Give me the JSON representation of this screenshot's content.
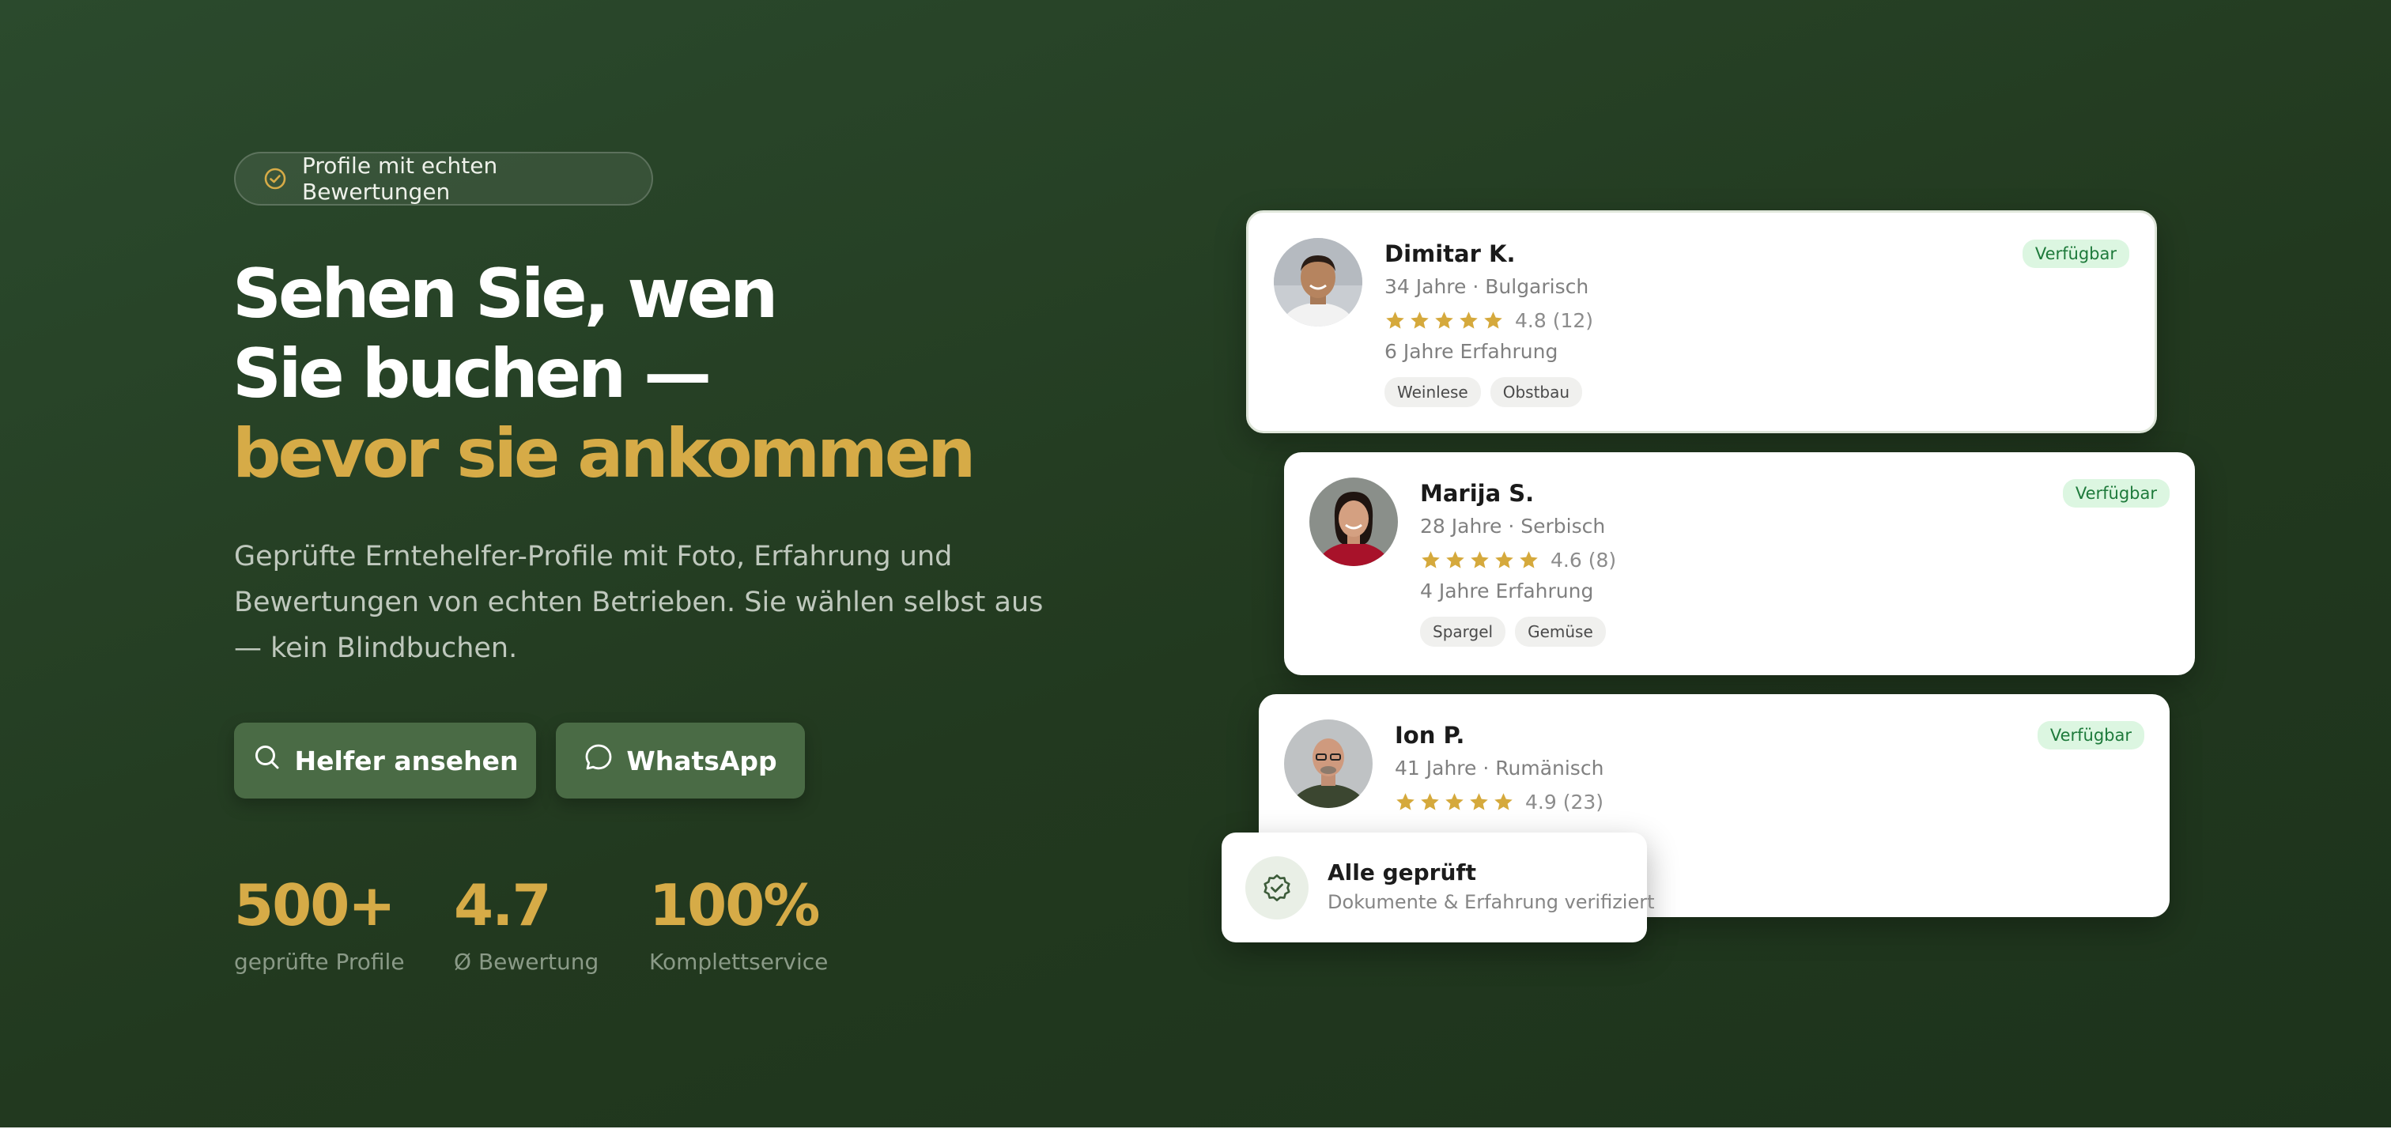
{
  "badge": {
    "text": "Profile mit echten Bewertungen",
    "icon": "check-circle-icon"
  },
  "headline": {
    "line1": "Sehen Sie, wen",
    "line2": "Sie buchen —",
    "line3": "bevor sie ankommen"
  },
  "lead": "Geprüfte Erntehelfer-Profile mit Foto, Erfahrung und Bewertungen von echten Betrieben. Sie wählen selbst aus — kein Blindbuchen.",
  "buttons": {
    "helpers": {
      "label": "Helfer ansehen",
      "icon": "search-icon"
    },
    "whatsapp": {
      "label": "WhatsApp",
      "icon": "chat-bubble-icon"
    }
  },
  "stats": [
    {
      "value": "500+",
      "label": "geprüfte Profile"
    },
    {
      "value": "4.7",
      "label": "Ø Bewertung"
    },
    {
      "value": "100%",
      "label": "Komplettservice"
    }
  ],
  "cards": [
    {
      "name": "Dimitar K.",
      "meta": "34 Jahre · Bulgarisch",
      "stars": 5,
      "rating": "4.8 (12)",
      "experience": "6 Jahre Erfahrung",
      "tags": [
        "Weinlese",
        "Obstbau"
      ],
      "status": "Verfügbar"
    },
    {
      "name": "Marija S.",
      "meta": "28 Jahre · Serbisch",
      "stars": 5,
      "rating": "4.6 (8)",
      "experience": "4 Jahre Erfahrung",
      "tags": [
        "Spargel",
        "Gemüse"
      ],
      "status": "Verfügbar"
    },
    {
      "name": "Ion P.",
      "meta": "41 Jahre · Rumänisch",
      "stars": 5,
      "rating": "4.9 (23)",
      "status": "Verfügbar"
    }
  ],
  "verified": {
    "title": "Alle geprüft",
    "subtitle": "Dokumente & Erfahrung verifiziert",
    "icon": "verified-badge-icon"
  },
  "colors": {
    "background": "#22391f",
    "accent_gold": "#d6ab47",
    "button_green": "#4a6b45",
    "star": "#d5a93c",
    "status_bg": "#dcf6e1",
    "status_text": "#1e7a3b"
  }
}
